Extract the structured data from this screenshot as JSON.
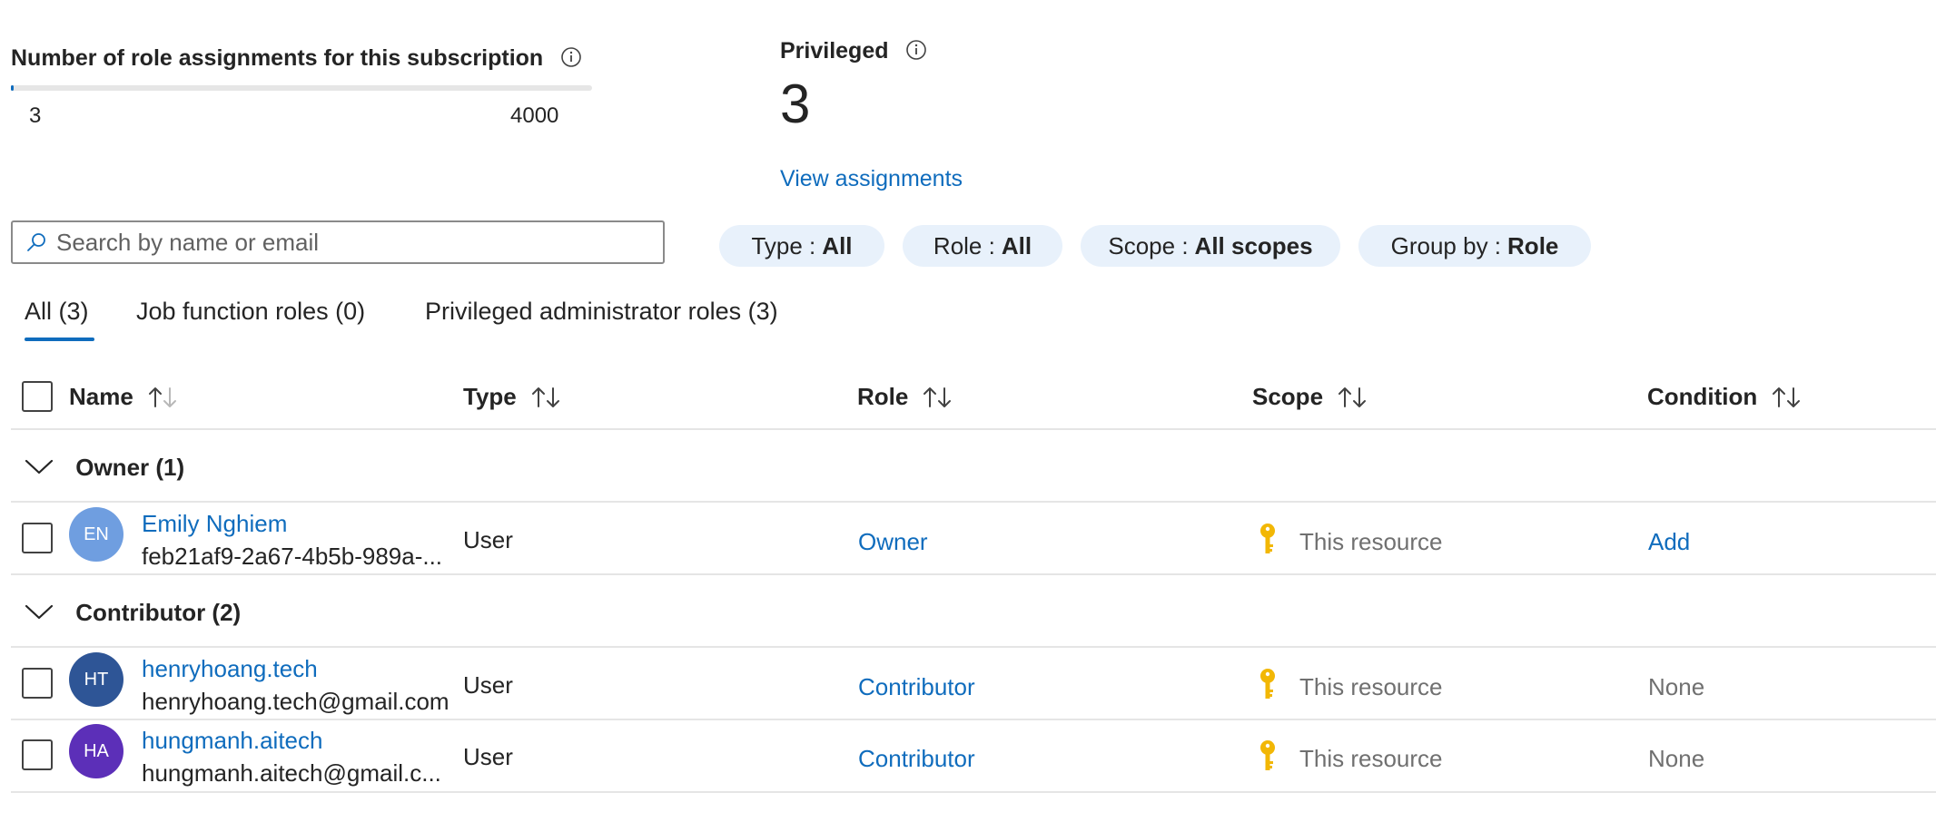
{
  "summary": {
    "title": "Number of role assignments for this subscription",
    "used": "3",
    "limit": "4000",
    "usage_fraction": 0.00075
  },
  "privileged": {
    "title": "Privileged",
    "count": "3",
    "link": "View assignments"
  },
  "search": {
    "placeholder": "Search by name or email"
  },
  "filters": [
    {
      "label": "Type :",
      "value": "All"
    },
    {
      "label": "Role :",
      "value": "All"
    },
    {
      "label": "Scope :",
      "value": "All scopes"
    },
    {
      "label": "Group by :",
      "value": "Role"
    }
  ],
  "tabs": [
    {
      "label": "All (3)",
      "selected": true
    },
    {
      "label": "Job function roles (0)",
      "selected": false
    },
    {
      "label": "Privileged administrator roles (3)",
      "selected": false
    }
  ],
  "columns": [
    "Name",
    "Type",
    "Role",
    "Scope",
    "Condition"
  ],
  "groups": [
    {
      "label": "Owner (1)",
      "rows": [
        {
          "initials": "EN",
          "avatar_color": "#6f9ee0",
          "name": "Emily Nghiem",
          "sub": "feb21af9-2a67-4b5b-989a-...",
          "type": "User",
          "role": "Owner",
          "scope": "This resource",
          "condition": "Add",
          "condition_is_link": true
        }
      ]
    },
    {
      "label": "Contributor (2)",
      "rows": [
        {
          "initials": "HT",
          "avatar_color": "#2e5596",
          "name": "henryhoang.tech",
          "sub": "henryhoang.tech@gmail.com",
          "type": "User",
          "role": "Contributor",
          "scope": "This resource",
          "condition": "None",
          "condition_is_link": false
        },
        {
          "initials": "HA",
          "avatar_color": "#5c2fb8",
          "name": "hungmanh.aitech",
          "sub": "hungmanh.aitech@gmail.c...",
          "type": "User",
          "role": "Contributor",
          "scope": "This resource",
          "condition": "None",
          "condition_is_link": false
        }
      ]
    }
  ],
  "icons": {
    "info": "info-icon",
    "search": "search-icon",
    "sort": "sort-icon",
    "chevron": "chevron-down-icon",
    "key": "key-icon"
  },
  "colors": {
    "accent": "#0f6cbd",
    "pill_bg": "#e8f1fb",
    "key": "#f2b705"
  }
}
